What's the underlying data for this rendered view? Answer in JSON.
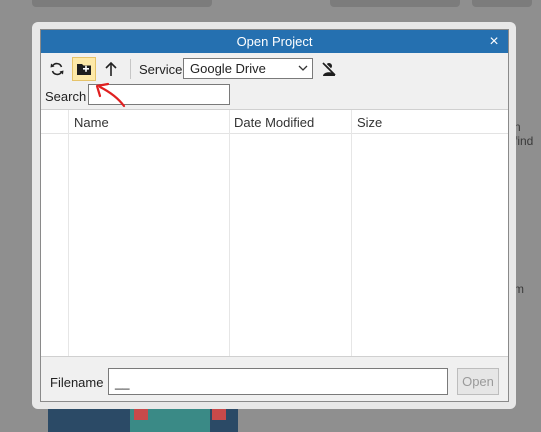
{
  "dialog": {
    "title": "Open Project",
    "close_icon": "×"
  },
  "toolbar": {
    "refresh_icon": "refresh-icon",
    "new_folder_icon": "new-folder-icon",
    "up_icon": "arrow-up-icon",
    "service_label": "Service",
    "service_selected": "Google Drive",
    "account_icon": "user-remove-icon"
  },
  "search": {
    "label": "Search",
    "value": ""
  },
  "table": {
    "columns": [
      "Name",
      "Date Modified",
      "Size"
    ],
    "rows": []
  },
  "footer": {
    "filename_label": "Filename",
    "filename_value": "__",
    "open_label": "Open"
  },
  "background": {
    "side_text": [
      "i",
      "n find",
      "m"
    ]
  },
  "colors": {
    "titlebar": "#2570b0",
    "active_button": "#fde9a8",
    "annotation_arrow": "#e02020"
  }
}
